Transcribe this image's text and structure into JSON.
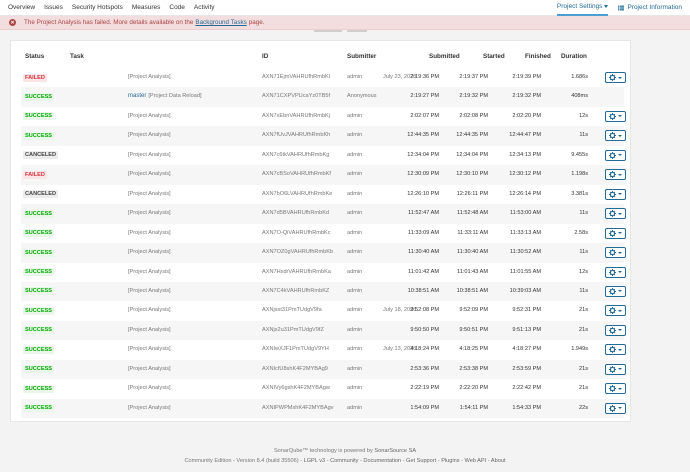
{
  "nav": {
    "tabs": [
      "Overview",
      "Issues",
      "Security Hotspots",
      "Measures",
      "Code",
      "Activity"
    ],
    "project_settings": "Project Settings",
    "project_information": "Project Information"
  },
  "alert": {
    "prefix": "The Project Analysis has failed. More details available on the",
    "link": "Background Tasks",
    "suffix": "page."
  },
  "table": {
    "headers": {
      "status": "Status",
      "task": "Task",
      "id": "ID",
      "submitter": "Submitter",
      "submitted": "Submitted",
      "started": "Started",
      "finished": "Finished",
      "duration": "Duration"
    },
    "rows": [
      {
        "status": "FAILED",
        "kind": "failed",
        "branch": "",
        "task": "[Project Analysis]",
        "id": "AXN71EjmVAHRUfhRmbKl",
        "submitter": "admin",
        "date": "July 23, 2020",
        "submitted": "2:19:36 PM",
        "started": "2:19:37 PM",
        "finished": "2:19:39 PM",
        "duration": "1.686s",
        "has_actions": true
      },
      {
        "status": "SUCCESS",
        "kind": "success",
        "branch": "master",
        "task": "[Project Data Reload]",
        "id": "AXN71CXPVPUcaYz0TB5f",
        "submitter": "Anonymous",
        "date": "",
        "submitted": "2:19:27 PM",
        "started": "2:19:32 PM",
        "finished": "2:19:32 PM",
        "duration": "408ms",
        "has_actions": false
      },
      {
        "status": "SUCCESS",
        "kind": "success",
        "branch": "",
        "task": "[Project Analysis]",
        "id": "AXN7xEbnVAHRUfhRmbKj",
        "submitter": "admin",
        "date": "",
        "submitted": "2:02:07 PM",
        "started": "2:02:08 PM",
        "finished": "2:02:20 PM",
        "duration": "12s",
        "has_actions": true
      },
      {
        "status": "SUCCESS",
        "kind": "success",
        "branch": "",
        "task": "[Project Analysis]",
        "id": "AXN7fUvJVAHRUfhRmbKh",
        "submitter": "admin",
        "date": "",
        "submitted": "12:44:35 PM",
        "started": "12:44:35 PM",
        "finished": "12:44:47 PM",
        "duration": "11s",
        "has_actions": true
      },
      {
        "status": "CANCELED",
        "kind": "canceled",
        "branch": "",
        "task": "[Project Analysis]",
        "id": "AXN7c6tkVAHRUfhRmbKg",
        "submitter": "admin",
        "date": "",
        "submitted": "12:34:04 PM",
        "started": "12:34:04 PM",
        "finished": "12:34:13 PM",
        "duration": "9.455s",
        "has_actions": true
      },
      {
        "status": "FAILED",
        "kind": "failed",
        "branch": "",
        "task": "[Project Analysis]",
        "id": "AXN7cBSoVAHRUfhRmbKf",
        "submitter": "admin",
        "date": "",
        "submitted": "12:30:09 PM",
        "started": "12:30:10 PM",
        "finished": "12:30:12 PM",
        "duration": "1.198s",
        "has_actions": true
      },
      {
        "status": "CANCELED",
        "kind": "canceled",
        "branch": "",
        "task": "[Project Analysis]",
        "id": "AXN7bO6LVAHRUfhRmbKe",
        "submitter": "admin",
        "date": "",
        "submitted": "12:26:10 PM",
        "started": "12:26:11 PM",
        "finished": "12:26:14 PM",
        "duration": "3.381s",
        "has_actions": true
      },
      {
        "status": "SUCCESS",
        "kind": "success",
        "branch": "",
        "task": "[Project Analysis]",
        "id": "AXN7d5BVAHRUfhRmbKd",
        "submitter": "admin",
        "date": "",
        "submitted": "11:52:47 AM",
        "started": "11:52:48 AM",
        "finished": "11:53:00 AM",
        "duration": "11s",
        "has_actions": true
      },
      {
        "status": "SUCCESS",
        "kind": "success",
        "branch": "",
        "task": "[Project Analysis]",
        "id": "AXN7O-QiVAHRUfhRmbKc",
        "submitter": "admin",
        "date": "",
        "submitted": "11:33:09 AM",
        "started": "11:33:11 AM",
        "finished": "11:33:13 AM",
        "duration": "2.58s",
        "has_actions": true
      },
      {
        "status": "SUCCESS",
        "kind": "success",
        "branch": "",
        "task": "[Project Analysis]",
        "id": "AXN7OZ0gVAHRUfhRmbKb",
        "submitter": "admin",
        "date": "",
        "submitted": "11:30:40 AM",
        "started": "11:30:40 AM",
        "finished": "11:30:52 AM",
        "duration": "11s",
        "has_actions": true
      },
      {
        "status": "SUCCESS",
        "kind": "success",
        "branch": "",
        "task": "[Project Analysis]",
        "id": "AXN7HxdrVAHRUfhRmbKa",
        "submitter": "admin",
        "date": "",
        "submitted": "11:01:42 AM",
        "started": "11:01:43 AM",
        "finished": "11:01:55 AM",
        "duration": "12s",
        "has_actions": true
      },
      {
        "status": "SUCCESS",
        "kind": "success",
        "branch": "",
        "task": "[Project Analysis]",
        "id": "AXN7C4kVAHRUfhRmbKZ",
        "submitter": "admin",
        "date": "",
        "submitted": "10:38:51 AM",
        "started": "10:38:51 AM",
        "finished": "10:39:03 AM",
        "duration": "11s",
        "has_actions": true
      },
      {
        "status": "SUCCESS",
        "kind": "success",
        "branch": "",
        "task": "[Project Analysis]",
        "id": "AXNjsst31PmTUdgV9fa",
        "submitter": "admin",
        "date": "July 18, 2020",
        "submitted": "9:52:08 PM",
        "started": "9:52:09 PM",
        "finished": "9:52:31 PM",
        "duration": "21s",
        "has_actions": true
      },
      {
        "status": "SUCCESS",
        "kind": "success",
        "branch": "",
        "task": "[Project Analysis]",
        "id": "AXNjs2u31PmTUdgV9fZ",
        "submitter": "admin",
        "date": "",
        "submitted": "9:50:50 PM",
        "started": "9:50:51 PM",
        "finished": "9:51:13 PM",
        "duration": "21s",
        "has_actions": true
      },
      {
        "status": "SUCCESS",
        "kind": "success",
        "branch": "",
        "task": "[Project Analysis]",
        "id": "AXNIwXJF1PmTUdgV9YH",
        "submitter": "admin",
        "date": "July 13, 2020",
        "submitted": "4:18:24 PM",
        "started": "4:18:25 PM",
        "finished": "4:18:27 PM",
        "duration": "1.949s",
        "has_actions": true
      },
      {
        "status": "SUCCESS",
        "kind": "success",
        "branch": "",
        "task": "[Project Analysis]",
        "id": "AXNIcfU8shK4F2MYBAg9",
        "submitter": "admin",
        "date": "",
        "submitted": "2:53:36 PM",
        "started": "2:53:38 PM",
        "finished": "2:53:59 PM",
        "duration": "21s",
        "has_actions": true
      },
      {
        "status": "SUCCESS",
        "kind": "success",
        "branch": "",
        "task": "[Project Analysis]",
        "id": "AXNIVy6gshK4F2MYBAgw",
        "submitter": "admin",
        "date": "",
        "submitted": "2:22:19 PM",
        "started": "2:22:20 PM",
        "finished": "2:22:42 PM",
        "duration": "21s",
        "has_actions": true
      },
      {
        "status": "SUCCESS",
        "kind": "success",
        "branch": "",
        "task": "[Project Analysis]",
        "id": "AXNIPWPMshK4F2MYBAgv",
        "submitter": "admin",
        "date": "",
        "submitted": "1:54:09 PM",
        "started": "1:54:11 PM",
        "finished": "1:54:33 PM",
        "duration": "22s",
        "has_actions": true
      }
    ]
  },
  "footer": {
    "line1_prefix": "SonarQube™ technology is powered by",
    "line1_link": "SonarSource SA",
    "edition": "Community Edition - Version 8.4 (build 35506) -",
    "links": [
      "LGPL v3",
      "Community",
      "Documentation",
      "Get Support",
      "Plugins",
      "Web API",
      "About"
    ]
  },
  "colors": {
    "accent": "#236a97",
    "success": "#00aa00",
    "failed": "#d4333f",
    "alert_bg": "#f2dede"
  },
  "icons": {
    "error": "error-circle-icon",
    "gear": "gear-icon",
    "info": "info-icon"
  }
}
